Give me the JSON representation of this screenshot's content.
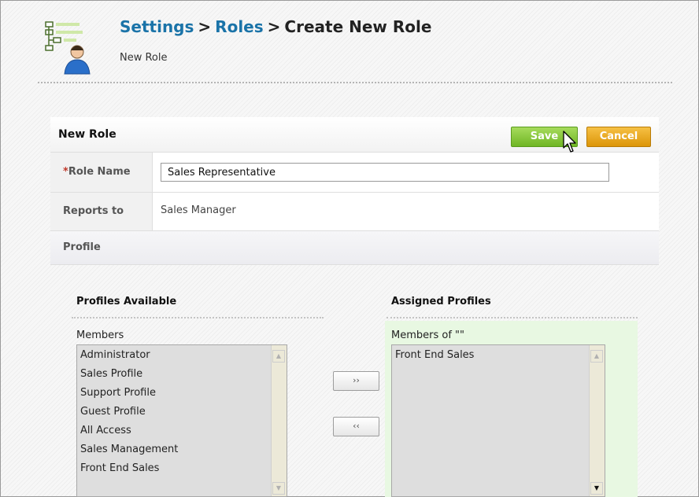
{
  "header": {
    "breadcrumb": [
      {
        "label": "Settings"
      },
      {
        "label": "Roles"
      },
      {
        "label": "Create New Role"
      }
    ],
    "separator": ">",
    "subtitle": "New Role",
    "icon": "roles-hierarchy-icon"
  },
  "form": {
    "title": "New Role",
    "save_label": "Save",
    "cancel_label": "Cancel",
    "role_name": {
      "required_mark": "*",
      "label": "Role Name",
      "value": "Sales Representative"
    },
    "reports_to": {
      "label": "Reports to",
      "value": "Sales Manager"
    },
    "profile": {
      "label": "Profile"
    }
  },
  "profiles": {
    "available": {
      "title": "Profiles Available",
      "members_label": "Members",
      "items": [
        "Administrator",
        "Sales Profile",
        "Support Profile",
        "Guest Profile",
        "All Access",
        "Sales Management",
        "Front End Sales"
      ]
    },
    "assigned": {
      "title": "Assigned Profiles",
      "members_label": "Members of \"\"",
      "items": [
        "Front End Sales"
      ]
    },
    "add_button": "››",
    "remove_button": "‹‹"
  },
  "colors": {
    "link": "#1a73a8",
    "save_button": "#7cc12f",
    "cancel_button": "#e8a314",
    "assigned_bg": "#e8f8e2",
    "required_mark": "#c0392b"
  }
}
